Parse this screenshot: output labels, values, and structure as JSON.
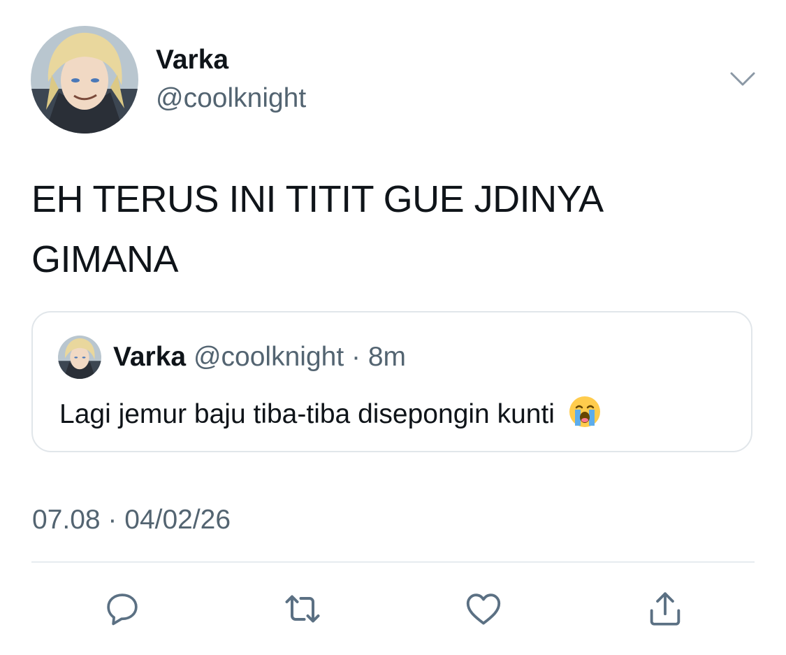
{
  "author": {
    "display_name": "Varka",
    "handle": "@coolknight"
  },
  "tweet": {
    "text_line1": "EH TERUS INI TITIT GUE JDINYA",
    "text_line2": "GIMANA",
    "timestamp": "07.08 · 04/02/26"
  },
  "quoted_tweet": {
    "display_name": "Varka",
    "handle": "@coolknight",
    "separator": "·",
    "age": "8m",
    "text": "Lagi jemur baju tiba-tiba disepongin kunti",
    "emoji_icon": "loudly-crying-face-emoji"
  },
  "actions": [
    {
      "name": "reply",
      "icon": "reply-icon"
    },
    {
      "name": "retweet",
      "icon": "retweet-icon"
    },
    {
      "name": "like",
      "icon": "heart-icon"
    },
    {
      "name": "share",
      "icon": "share-icon"
    }
  ],
  "colors": {
    "text_primary": "#0f1419",
    "text_secondary": "#536471",
    "icon": "#5b7083",
    "border": "#e1e6ea"
  }
}
